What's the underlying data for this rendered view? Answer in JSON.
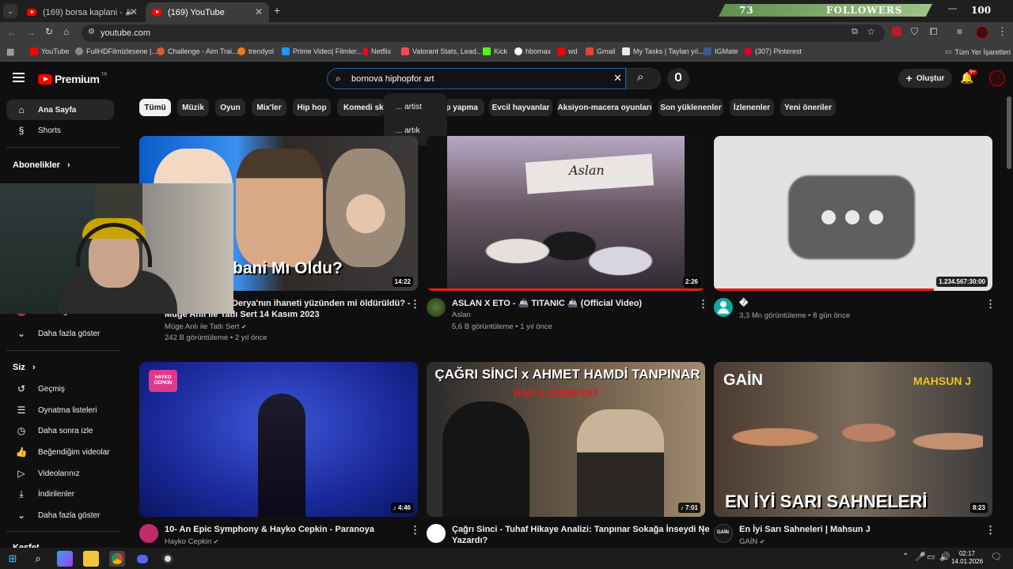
{
  "tabs": [
    {
      "title": "(169) borsa kaplani - YouTu"
    },
    {
      "title": "(169) YouTube"
    }
  ],
  "followers_overlay": {
    "count": "73",
    "label": "FOLLOWERS",
    "right_value": "100"
  },
  "address": {
    "url": "youtube.com"
  },
  "bookmarks": [
    {
      "label": "YouTube",
      "color": "#ff0000"
    },
    {
      "label": "FullHDFilmizlesene |...",
      "color": "#888888"
    },
    {
      "label": "Challenge - Aim Trai...",
      "color": "#e05a2b"
    },
    {
      "label": "trendyol",
      "color": "#f27a1a"
    },
    {
      "label": "Prime Video| Filmler...",
      "color": "#1a98ff"
    },
    {
      "label": "Netflix",
      "color": "#e50914"
    },
    {
      "label": "Valorant Stats, Lead...",
      "color": "#ff4655"
    },
    {
      "label": "Kick",
      "color": "#53fc18"
    },
    {
      "label": "hbomax",
      "color": "#ffffff"
    },
    {
      "label": "wd",
      "color": "#ff0000"
    },
    {
      "label": "Gmail",
      "color": "#ea4335"
    },
    {
      "label": "My Tasks | Taylan yıl...",
      "color": "#e8eaed"
    },
    {
      "label": "IGMate",
      "color": "#3b5998"
    },
    {
      "label": "(307) Pinterest",
      "color": "#e60023"
    }
  ],
  "bookmarks_all": "Tüm Yer İşaretleri",
  "header": {
    "logo_text": "Premium",
    "logo_badge": "TR",
    "search_value": "bornova hiphopfor art",
    "create_label": "Oluştur",
    "notif_count": "9+"
  },
  "suggestions": [
    "... artist",
    "... artık"
  ],
  "chips": [
    "Tümü",
    "Müzik",
    "Oyun",
    "Mix'ler",
    "Hip hop",
    "Komedi ske",
    "ap yapma",
    "Evcil hayvanlar",
    "Aksiyon-macera oyunları",
    "Son yüklenenler",
    "İzlenenler",
    "Yeni öneriler"
  ],
  "sidebar": {
    "home": "Ana Sayfa",
    "shorts": "Shorts",
    "subs_head": "Abonelikler",
    "partial_channel": "Emin Ağae",
    "more1": "Daha fazla göster",
    "you_head": "Siz",
    "history": "Geçmiş",
    "playlists": "Oynatma listeleri",
    "watch_later": "Daha sonra izle",
    "liked": "Beğendiğim videolar",
    "your_videos": "Videolarınız",
    "downloads": "İndirilenler",
    "more2": "Daha fazla göster",
    "explore_head": "Keşfet"
  },
  "videos": [
    {
      "title_line1": "Derya'nın ihaneti yüzünden mi öldürüldü? -",
      "title_line2": "Müge Anlı ile Tatlı Sert 14 Kasım 2023",
      "channel": "Müge Anlı ile Tatlı Sert",
      "meta": "242 B görüntüleme • 2 yıl önce",
      "duration": "14:22",
      "overlay_text": "bani Mı Oldu?"
    },
    {
      "title_line1": "ASLAN X ETO - 🚢 TITANIC 🚢 (Official Video)",
      "title_line2": "",
      "channel": "Aslan",
      "meta": "5,6 B görüntüleme • 1 yıl önce",
      "duration": "2:26",
      "overlay_text": "Aslan"
    },
    {
      "title_line1": "�",
      "title_line2": "",
      "channel": "",
      "meta": "3,3 Mn görüntüleme • 8 gün önce",
      "duration": "1.234.567:30:00",
      "overlay_text": ""
    },
    {
      "title_line1": "10- An Epic Symphony & Hayko Cepkin - Paranoya",
      "title_line2": "",
      "channel": "Hayko Cepkin",
      "meta": "",
      "duration": "4:46",
      "overlay_text": "HAYKO CEPKİN"
    },
    {
      "title_line1": "Çağrı Sinci - Tuhaf Hikaye Analizi: Tanpınar Sokağa İnseydi Ne",
      "title_line2": "Yazardı?",
      "channel": "",
      "meta": "",
      "duration": "7:01",
      "overlay_text": "ÇAĞRI SİNCİ x AHMET HAMDİ TANPINAR",
      "overlay_sub": "RAP & EDEBİYAT"
    },
    {
      "title_line1": "En İyi Sarı Sahneleri | Mahsun J",
      "title_line2": "",
      "channel": "GAİN",
      "meta": "",
      "duration": "8:23",
      "overlay_text": "EN İYİ SARI SAHNELERİ",
      "overlay_brand": "GAİN",
      "overlay_brand2": "MAHSUN J"
    }
  ],
  "taskbar": {
    "time": "02:17",
    "date": "14.01.2026"
  }
}
